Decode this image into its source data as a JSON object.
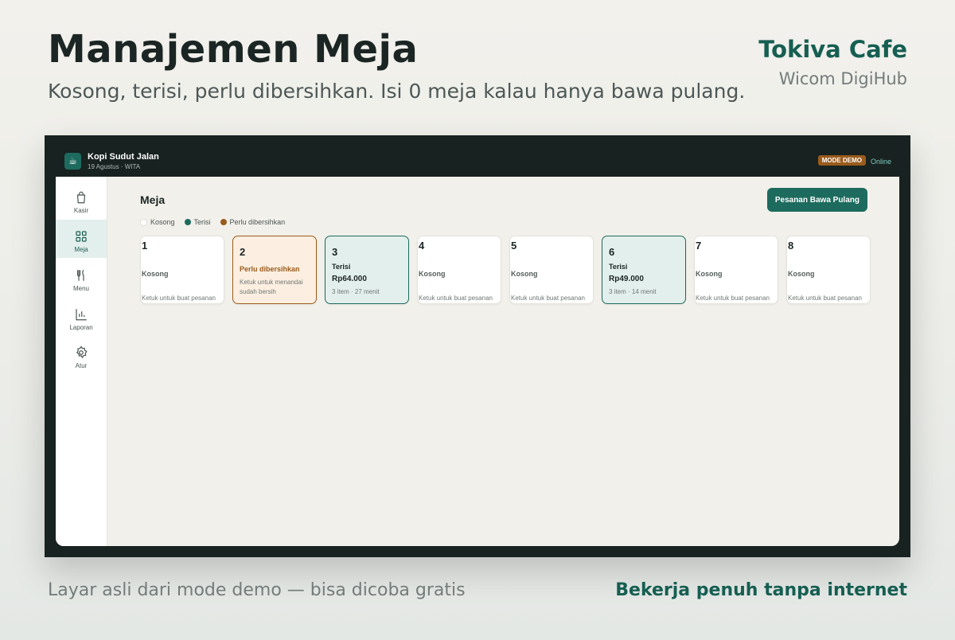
{
  "hero": {
    "title": "Manajemen Meja",
    "subtitle": "Kosong, terisi, perlu dibersihkan. Isi 0 meja kalau hanya bawa pulang.",
    "brand_name": "Tokiva Cafe",
    "brand_tagline": "Wicom DigiHub"
  },
  "footer": {
    "left": "Layar asli dari mode demo — bisa dicoba gratis",
    "right": "Bekerja penuh tanpa internet"
  },
  "app": {
    "name": "Kopi Sudut Jalan",
    "date": "19 Agustus · WITA",
    "demo_badge": "MODE DEMO",
    "status": "Online",
    "logo_icon": "coffee-cup-icon"
  },
  "sidebar": {
    "items": [
      {
        "label": "Kasir",
        "icon": "shopping-bag-icon"
      },
      {
        "label": "Meja",
        "icon": "grid-icon",
        "active": true
      },
      {
        "label": "Menu",
        "icon": "utensils-icon"
      },
      {
        "label": "Laporan",
        "icon": "bar-chart-icon"
      },
      {
        "label": "Atur",
        "icon": "gear-icon"
      }
    ]
  },
  "main": {
    "title": "Meja",
    "takeaway_button": "Pesanan Bawa Pulang",
    "legend": [
      {
        "label": "Kosong",
        "color": "#ffffff"
      },
      {
        "label": "Terisi",
        "color": "#1d6b5e"
      },
      {
        "label": "Perlu dibersihkan",
        "color": "#9a5b1c"
      }
    ],
    "tables": [
      {
        "number": "1",
        "status": "Kosong",
        "hint": "Ketuk untuk buat pesanan"
      },
      {
        "number": "2",
        "status": "Perlu dibersihkan",
        "hint": "Ketuk untuk menandai sudah bersih"
      },
      {
        "number": "3",
        "status": "Terisi",
        "amount": "Rp64.000",
        "meta": "3 item · 27 menit"
      },
      {
        "number": "4",
        "status": "Kosong",
        "hint": "Ketuk untuk buat pesanan"
      },
      {
        "number": "5",
        "status": "Kosong",
        "hint": "Ketuk untuk buat pesanan"
      },
      {
        "number": "6",
        "status": "Terisi",
        "amount": "Rp49.000",
        "meta": "3 item · 14 menit"
      },
      {
        "number": "7",
        "status": "Kosong",
        "hint": "Ketuk untuk buat pesanan"
      },
      {
        "number": "8",
        "status": "Kosong",
        "hint": "Ketuk untuk buat pesanan"
      }
    ]
  },
  "colors": {
    "accent": "#1d6b5e",
    "warning": "#9a5b1c",
    "frame": "#182220"
  }
}
